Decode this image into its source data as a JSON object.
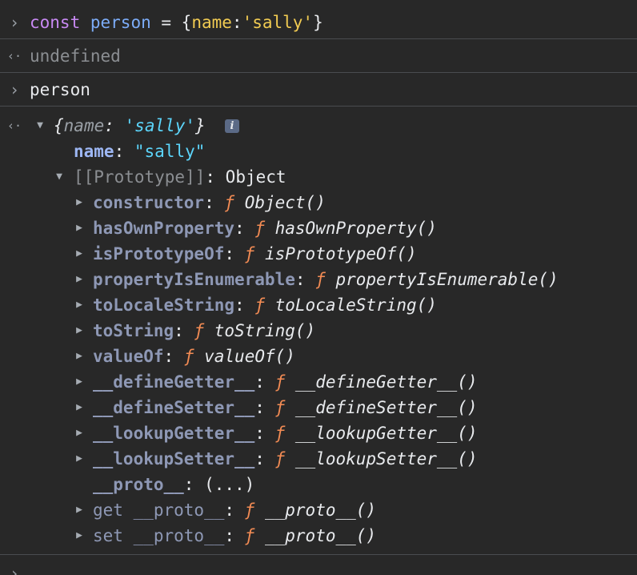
{
  "console": {
    "input1": {
      "kw": "const",
      "ident": "person",
      "eq": " = ",
      "open": "{",
      "key": "name",
      "colon": ":",
      "str": "'sally'",
      "close": "}"
    },
    "output1": "undefined",
    "input2": "person",
    "object_preview": {
      "open": "{",
      "key": "name",
      "colon": ": ",
      "value": "'sally'",
      "close": "}",
      "info_badge": "i"
    },
    "own_props": [
      {
        "key": "name",
        "colon": ": ",
        "value": "\"sally\""
      }
    ],
    "prototype": {
      "label": "[[Prototype]]",
      "colon": ": ",
      "value": "Object"
    },
    "proto_props": [
      {
        "key": "constructor",
        "sym": "ƒ",
        "fn": "Object()"
      },
      {
        "key": "hasOwnProperty",
        "sym": "ƒ",
        "fn": "hasOwnProperty()"
      },
      {
        "key": "isPrototypeOf",
        "sym": "ƒ",
        "fn": "isPrototypeOf()"
      },
      {
        "key": "propertyIsEnumerable",
        "sym": "ƒ",
        "fn": "propertyIsEnumerable()"
      },
      {
        "key": "toLocaleString",
        "sym": "ƒ",
        "fn": "toLocaleString()"
      },
      {
        "key": "toString",
        "sym": "ƒ",
        "fn": "toString()"
      },
      {
        "key": "valueOf",
        "sym": "ƒ",
        "fn": "valueOf()"
      },
      {
        "key": "__defineGetter__",
        "sym": "ƒ",
        "fn": "__defineGetter__()"
      },
      {
        "key": "__defineSetter__",
        "sym": "ƒ",
        "fn": "__defineSetter__()"
      },
      {
        "key": "__lookupGetter__",
        "sym": "ƒ",
        "fn": "__lookupGetter__()"
      },
      {
        "key": "__lookupSetter__",
        "sym": "ƒ",
        "fn": "__lookupSetter__()"
      }
    ],
    "proto_accessor": {
      "key": "__proto__",
      "colon": ": ",
      "value": "(...)"
    },
    "getter": {
      "key": "get __proto__",
      "sym": "ƒ",
      "fn": "__proto__()"
    },
    "setter": {
      "key": "set __proto__",
      "sym": "ƒ",
      "fn": "__proto__()"
    },
    "prompt_glyph": "›",
    "result_glyph": "‹·",
    "collapsed_glyph": "▶",
    "expanded_glyph": "▼",
    "colon": ": "
  }
}
